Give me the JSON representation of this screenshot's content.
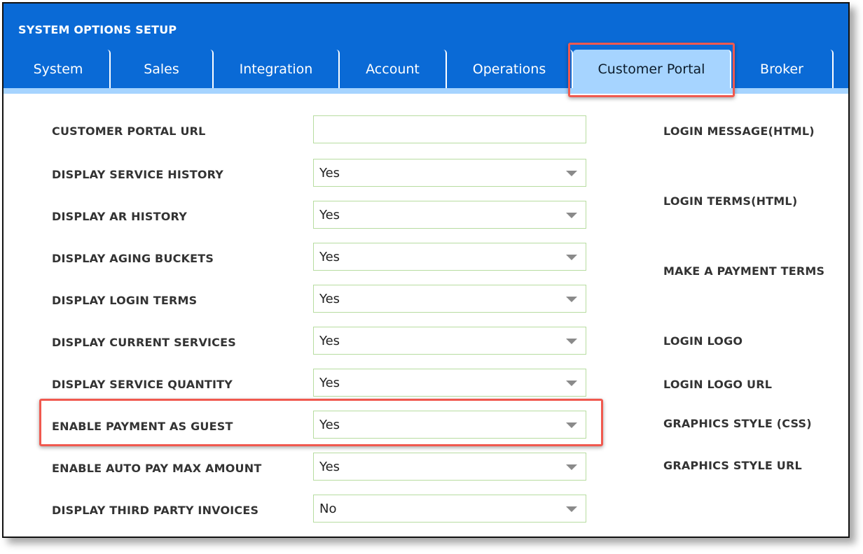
{
  "header": {
    "title": "SYSTEM OPTIONS SETUP"
  },
  "tabs": [
    {
      "label": "System"
    },
    {
      "label": "Sales"
    },
    {
      "label": "Integration"
    },
    {
      "label": "Account"
    },
    {
      "label": "Operations"
    },
    {
      "label": "Customer Portal",
      "active": true
    },
    {
      "label": "Broker"
    }
  ],
  "form": {
    "customer_portal_url": {
      "label": "CUSTOMER PORTAL URL",
      "value": ""
    },
    "display_service_history": {
      "label": "DISPLAY SERVICE HISTORY",
      "value": "Yes"
    },
    "display_ar_history": {
      "label": "DISPLAY AR HISTORY",
      "value": "Yes"
    },
    "display_aging_buckets": {
      "label": "DISPLAY AGING BUCKETS",
      "value": "Yes"
    },
    "display_login_terms": {
      "label": "DISPLAY LOGIN TERMS",
      "value": "Yes"
    },
    "display_current_services": {
      "label": "DISPLAY CURRENT SERVICES",
      "value": "Yes"
    },
    "display_service_quantity": {
      "label": "DISPLAY SERVICE QUANTITY",
      "value": "Yes"
    },
    "enable_payment_as_guest": {
      "label": "ENABLE PAYMENT AS GUEST",
      "value": "Yes"
    },
    "enable_auto_pay_max_amount": {
      "label": "ENABLE AUTO PAY MAX AMOUNT",
      "value": "Yes"
    },
    "display_third_party_invoices": {
      "label": "DISPLAY THIRD PARTY INVOICES",
      "value": "No"
    }
  },
  "side": {
    "login_message": "LOGIN MESSAGE(HTML)",
    "login_terms": "LOGIN TERMS(HTML)",
    "make_payment_terms": "MAKE A PAYMENT TERMS",
    "login_logo": "LOGIN LOGO",
    "login_logo_url": "LOGIN LOGO URL",
    "graphics_style": "GRAPHICS STYLE (CSS)",
    "graphics_style_url": "GRAPHICS STYLE URL"
  },
  "colors": {
    "header_blue": "#0a6ad6",
    "active_tab": "#a6d4ff",
    "highlight": "#f0594f",
    "field_border": "#b7dca0"
  },
  "icons": {
    "select_caret": "chevron-down-icon"
  }
}
